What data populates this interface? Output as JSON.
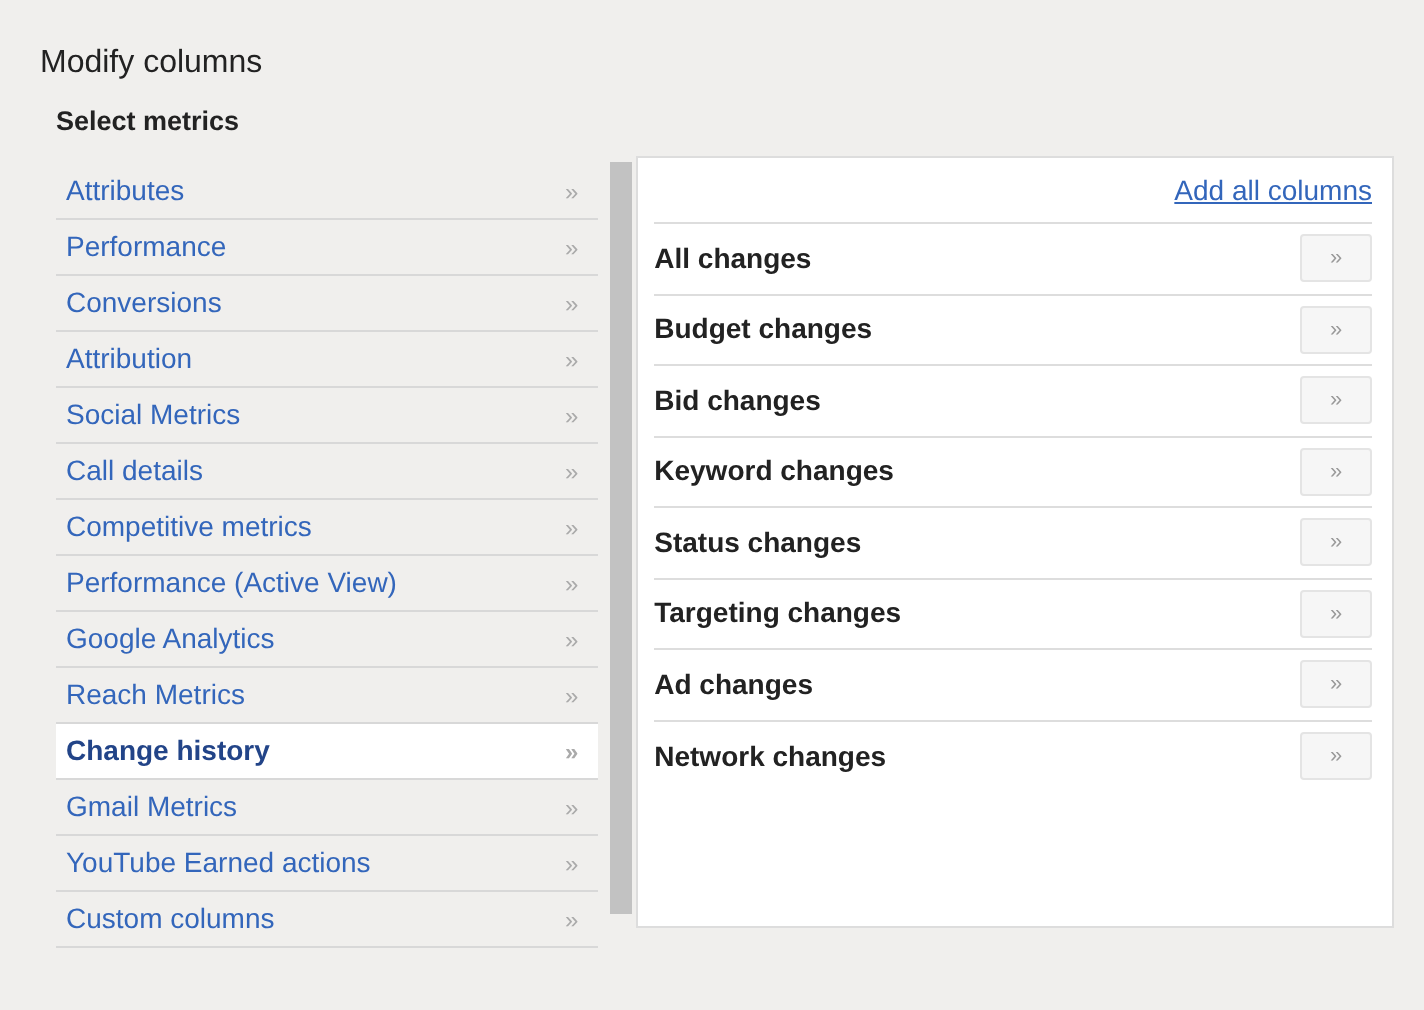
{
  "title": "Modify columns",
  "section_heading": "Select metrics",
  "categories": [
    {
      "label": "Attributes",
      "arrow": "»",
      "selected": false
    },
    {
      "label": "Performance",
      "arrow": "»",
      "selected": false
    },
    {
      "label": "Conversions",
      "arrow": "»",
      "selected": false
    },
    {
      "label": "Attribution",
      "arrow": "»",
      "selected": false
    },
    {
      "label": "Social Metrics",
      "arrow": "»",
      "selected": false
    },
    {
      "label": "Call details",
      "arrow": "»",
      "selected": false
    },
    {
      "label": "Competitive metrics",
      "arrow": "»",
      "selected": false
    },
    {
      "label": "Performance (Active View)",
      "arrow": "»",
      "selected": false
    },
    {
      "label": "Google Analytics",
      "arrow": "»",
      "selected": false
    },
    {
      "label": "Reach Metrics",
      "arrow": "»",
      "selected": false
    },
    {
      "label": "Change history",
      "arrow": "»",
      "selected": true
    },
    {
      "label": "Gmail Metrics",
      "arrow": "»",
      "selected": false
    },
    {
      "label": "YouTube Earned actions",
      "arrow": "»",
      "selected": false
    },
    {
      "label": "Custom columns",
      "arrow": "»",
      "selected": false
    }
  ],
  "panel": {
    "add_all": "Add all columns",
    "metrics": [
      {
        "label": "All changes",
        "button": "»"
      },
      {
        "label": "Budget changes",
        "button": "»"
      },
      {
        "label": "Bid changes",
        "button": "»"
      },
      {
        "label": "Keyword changes",
        "button": "»"
      },
      {
        "label": "Status changes",
        "button": "»"
      },
      {
        "label": "Targeting changes",
        "button": "»"
      },
      {
        "label": "Ad changes",
        "button": "»"
      },
      {
        "label": "Network changes",
        "button": "»"
      }
    ]
  }
}
